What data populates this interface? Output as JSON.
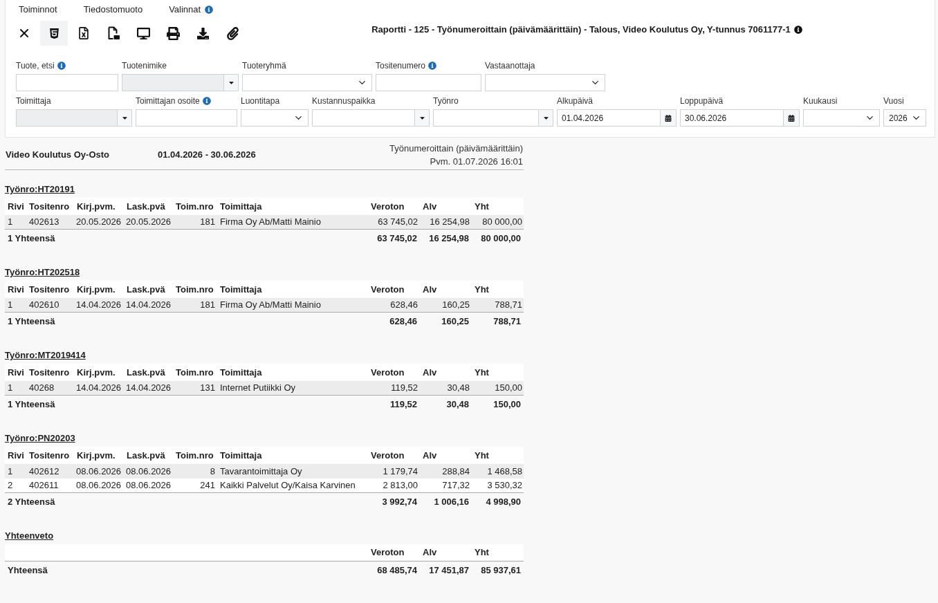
{
  "menu": [
    {
      "label": "Toiminnot",
      "info": false
    },
    {
      "label": "Tiedostomuoto",
      "info": false
    },
    {
      "label": "Valinnat",
      "info": true
    }
  ],
  "toolbar": [
    {
      "kind": "close",
      "selected": false
    },
    {
      "kind": "html",
      "selected": true
    },
    {
      "kind": "excel",
      "selected": false
    },
    {
      "kind": "pdf",
      "selected": false
    },
    {
      "kind": "screen",
      "selected": false
    },
    {
      "kind": "print",
      "selected": false
    },
    {
      "kind": "download",
      "selected": false
    },
    {
      "kind": "attach",
      "selected": false
    }
  ],
  "title": {
    "text": "Raportti - 125 - Työnumeroittain (päivämäärittäin) - Talous, Video Koulutus Oy, Y-tunnus 7061177-1",
    "info": true
  },
  "filters": [
    [
      {
        "label": "Tuote, etsi",
        "kind": "text",
        "info": true,
        "disabled": false
      },
      {
        "label": "Tuotenimike",
        "kind": "combo",
        "info": false,
        "disabled": true
      },
      {
        "label": "Tuoteryhmä",
        "kind": "select",
        "info": false,
        "disabled": false
      },
      {
        "label": "Tositenumero",
        "kind": "text",
        "info": true,
        "disabled": false
      },
      {
        "label": "Vastaanottaja",
        "kind": "select",
        "info": false,
        "disabled": false
      }
    ],
    [
      {
        "label": "Toimittaja",
        "kind": "combo",
        "info": false,
        "disabled": true
      },
      {
        "label": "Toimittajan osoite",
        "kind": "text",
        "info": true,
        "disabled": false
      },
      {
        "label": "Luontitapa",
        "kind": "select",
        "info": false,
        "disabled": false
      },
      {
        "label": "Kustannuspaikka",
        "kind": "combo",
        "info": false,
        "disabled": false
      },
      {
        "label": "Työnro",
        "kind": "combo",
        "info": false,
        "disabled": false
      },
      {
        "label": "Alkupäivä",
        "kind": "date",
        "info": false,
        "disabled": false,
        "value": "01.04.2026"
      },
      {
        "label": "Loppupäivä",
        "kind": "date",
        "info": false,
        "disabled": false,
        "value": "30.06.2026"
      },
      {
        "label": "Kuukausi",
        "kind": "select",
        "info": false,
        "disabled": false
      },
      {
        "label": "Vuosi",
        "kind": "select",
        "info": false,
        "disabled": false,
        "value": "2026"
      }
    ]
  ],
  "report": {
    "company": "Video Koulutus Oy-Osto",
    "period": "01.04.2026 - 30.06.2026",
    "report_type": "Työnumeroittain (päivämäärittäin)",
    "printed": "Pvm. 01.07.2026 16:01",
    "groups": [
      {
        "heading": "Työnro:HT20191",
        "columns": [
          "Rivi",
          "Tositenro",
          "Kirj.pvm.",
          "Lask.pvä",
          "Toim.nro",
          "Toimittaja",
          "Veroton",
          "Alv",
          "Yht"
        ],
        "rows": [
          [
            "1",
            "402613",
            "20.05.2026",
            "20.05.2026",
            "181",
            "Firma Oy Ab/Matti Mainio",
            "63 745,02",
            "16 254,98",
            "80 000,00"
          ]
        ],
        "total": {
          "label": "1 Yhteensä",
          "values": [
            "63 745,02",
            "16 254,98",
            "80 000,00"
          ]
        }
      },
      {
        "heading": "Työnro:HT202518",
        "columns": [
          "Rivi",
          "Tositenro",
          "Kirj.pvm.",
          "Lask.pvä",
          "Toim.nro",
          "Toimittaja",
          "Veroton",
          "Alv",
          "Yht"
        ],
        "rows": [
          [
            "1",
            "402610",
            "14.04.2026",
            "14.04.2026",
            "181",
            "Firma Oy Ab/Matti Mainio",
            "628,46",
            "160,25",
            "788,71"
          ]
        ],
        "total": {
          "label": "1 Yhteensä",
          "values": [
            "628,46",
            "160,25",
            "788,71"
          ]
        }
      },
      {
        "heading": "Työnro:MT2019414",
        "columns": [
          "Rivi",
          "Tositenro",
          "Kirj.pvm.",
          "Lask.pvä",
          "Toim.nro",
          "Toimittaja",
          "Veroton",
          "Alv",
          "Yht"
        ],
        "rows": [
          [
            "1",
            "40268",
            "14.04.2026",
            "14.04.2026",
            "131",
            "Internet Putiikki Oy",
            "119,52",
            "30,48",
            "150,00"
          ]
        ],
        "total": {
          "label": "1 Yhteensä",
          "values": [
            "119,52",
            "30,48",
            "150,00"
          ]
        }
      },
      {
        "heading": "Työnro:PN20203",
        "columns": [
          "Rivi",
          "Tositenro",
          "Kirj.pvm.",
          "Lask.pvä",
          "Toim.nro",
          "Toimittaja",
          "Veroton",
          "Alv",
          "Yht"
        ],
        "rows": [
          [
            "1",
            "402612",
            "08.06.2026",
            "08.06.2026",
            "8",
            "Tavarantoimittaja Oy",
            "1 179,74",
            "288,84",
            "1 468,58"
          ],
          [
            "2",
            "402611",
            "08.06.2026",
            "08.06.2026",
            "241",
            "Kaikki Palvelut Oy/Kaisa Karvinen",
            "2 813,00",
            "717,32",
            "3 530,32"
          ]
        ],
        "total": {
          "label": "2 Yhteensä",
          "values": [
            "3 992,74",
            "1 006,16",
            "4 998,90"
          ]
        }
      }
    ],
    "summary": {
      "heading": "Yhteenveto",
      "columns": [
        "Veroton",
        "Alv",
        "Yht"
      ],
      "total": {
        "label": "Yhteensä",
        "values": [
          "68 485,74",
          "17 451,87",
          "85 937,61"
        ]
      }
    }
  }
}
